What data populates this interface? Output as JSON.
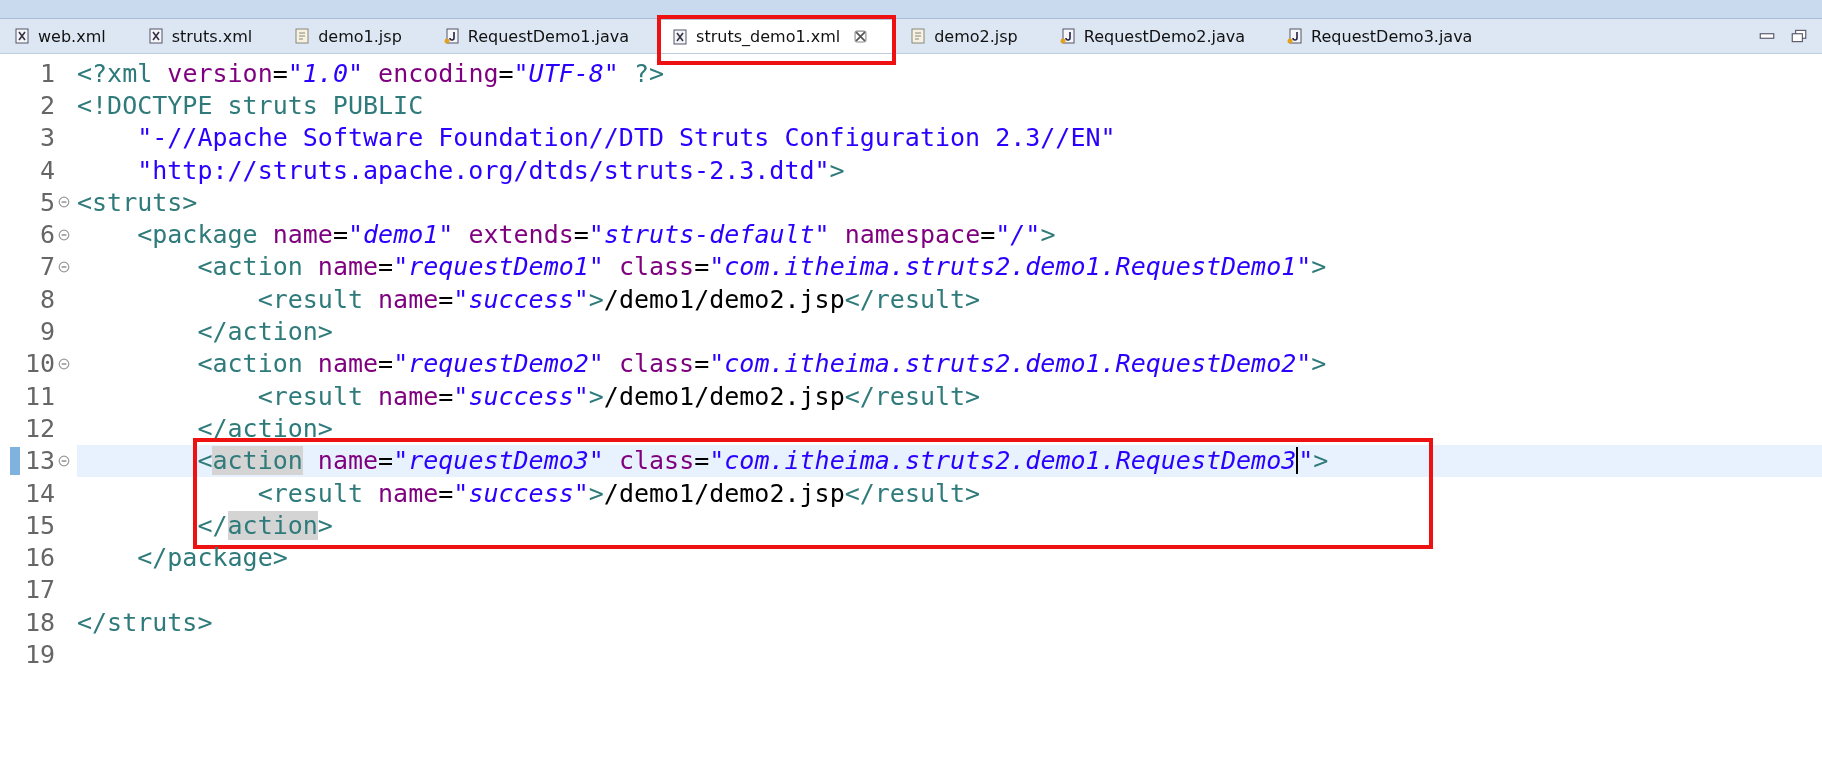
{
  "tabs": [
    {
      "label": "web.xml",
      "kind": "xml",
      "selected": false
    },
    {
      "label": "struts.xml",
      "kind": "xml",
      "selected": false
    },
    {
      "label": "demo1.jsp",
      "kind": "jsp",
      "selected": false
    },
    {
      "label": "RequestDemo1.java",
      "kind": "java",
      "selected": false
    },
    {
      "label": "struts_demo1.xml",
      "kind": "xml",
      "selected": true,
      "boxed": true,
      "closable": true
    },
    {
      "label": "demo2.jsp",
      "kind": "jsp",
      "selected": false
    },
    {
      "label": "RequestDemo2.java",
      "kind": "java",
      "selected": false
    },
    {
      "label": "RequestDemo3.java",
      "kind": "java",
      "selected": false
    }
  ],
  "editor": {
    "sections": [
      {
        "lines": [
          {
            "number": "1",
            "tokens": [
              {
                "kind": "tag",
                "text": "<?xml"
              },
              {
                "kind": "attr",
                "text": " version"
              },
              {
                "kind": "plain",
                "text": "="
              },
              {
                "kind": "value",
                "text": "\"1.0\""
              },
              {
                "kind": "attr",
                "text": " encoding"
              },
              {
                "kind": "plain",
                "text": "="
              },
              {
                "kind": "value",
                "text": "\"UTF-8\""
              },
              {
                "kind": "tag",
                "text": " ?>"
              }
            ]
          },
          {
            "number": "2",
            "tokens": [
              {
                "kind": "tag",
                "text": "<!DOCTYPE struts PUBLIC"
              }
            ]
          },
          {
            "number": "3",
            "tokens": [
              {
                "kind": "string",
                "text": "    \"-//Apache Software Foundation//DTD Struts Configuration 2.3//EN\""
              }
            ]
          },
          {
            "number": "4",
            "tokens": [
              {
                "kind": "string",
                "text": "    \"http://struts.apache.org/dtds/struts-2.3.dtd\""
              },
              {
                "kind": "tag",
                "text": ">"
              }
            ]
          },
          {
            "number": "5",
            "fold": true,
            "tokens": [
              {
                "kind": "tag",
                "text": "<struts>"
              }
            ]
          },
          {
            "number": "6",
            "fold": true,
            "tokens": [
              {
                "kind": "tag",
                "text": "    <package"
              },
              {
                "kind": "attr",
                "text": " name"
              },
              {
                "kind": "plain",
                "text": "="
              },
              {
                "kind": "value",
                "text": "\"demo1\""
              },
              {
                "kind": "attr",
                "text": " extends"
              },
              {
                "kind": "plain",
                "text": "="
              },
              {
                "kind": "value",
                "text": "\"struts-default\""
              },
              {
                "kind": "attr",
                "text": " namespace"
              },
              {
                "kind": "plain",
                "text": "="
              },
              {
                "kind": "value",
                "text": "\"/\""
              },
              {
                "kind": "tag",
                "text": ">"
              }
            ]
          },
          {
            "number": "7",
            "fold": true,
            "tokens": [
              {
                "kind": "tag",
                "text": "        <action"
              },
              {
                "kind": "attr",
                "text": " name"
              },
              {
                "kind": "plain",
                "text": "="
              },
              {
                "kind": "value",
                "text": "\"requestDemo1\""
              },
              {
                "kind": "attr",
                "text": " class"
              },
              {
                "kind": "plain",
                "text": "="
              },
              {
                "kind": "value",
                "text": "\"com.itheima.struts2.demo1.RequestDemo1\""
              },
              {
                "kind": "tag",
                "text": ">"
              }
            ]
          },
          {
            "number": "8",
            "tokens": [
              {
                "kind": "tag",
                "text": "            <result"
              },
              {
                "kind": "attr",
                "text": " name"
              },
              {
                "kind": "plain",
                "text": "="
              },
              {
                "kind": "value",
                "text": "\"success\""
              },
              {
                "kind": "tag",
                "text": ">"
              },
              {
                "kind": "plain",
                "text": "/demo1/demo2.jsp"
              },
              {
                "kind": "tag",
                "text": "</result>"
              }
            ]
          },
          {
            "number": "9",
            "tokens": [
              {
                "kind": "tag",
                "text": "        </action>"
              }
            ]
          },
          {
            "number": "10",
            "fold": true,
            "tokens": [
              {
                "kind": "tag",
                "text": "        <action"
              },
              {
                "kind": "attr",
                "text": " name"
              },
              {
                "kind": "plain",
                "text": "="
              },
              {
                "kind": "value",
                "text": "\"requestDemo2\""
              },
              {
                "kind": "attr",
                "text": " class"
              },
              {
                "kind": "plain",
                "text": "="
              },
              {
                "kind": "value",
                "text": "\"com.itheima.struts2.demo1.RequestDemo2\""
              },
              {
                "kind": "tag",
                "text": ">"
              }
            ]
          },
          {
            "number": "11",
            "tokens": [
              {
                "kind": "tag",
                "text": "            <result"
              },
              {
                "kind": "attr",
                "text": " name"
              },
              {
                "kind": "plain",
                "text": "="
              },
              {
                "kind": "value",
                "text": "\"success\""
              },
              {
                "kind": "tag",
                "text": ">"
              },
              {
                "kind": "plain",
                "text": "/demo1/demo2.jsp"
              },
              {
                "kind": "tag",
                "text": "</result>"
              }
            ]
          },
          {
            "number": "12",
            "tokens": [
              {
                "kind": "tag",
                "text": "        </action>"
              }
            ]
          }
        ]
      },
      {
        "boxed": true,
        "lines": [
          {
            "number": "13",
            "fold": true,
            "current": true,
            "tokens": [
              {
                "kind": "tag",
                "text": "        <"
              },
              {
                "kind": "match",
                "text": "action"
              },
              {
                "kind": "attr",
                "text": " name"
              },
              {
                "kind": "plain",
                "text": "="
              },
              {
                "kind": "value",
                "text": "\"requestDemo3\""
              },
              {
                "kind": "attr",
                "text": " class"
              },
              {
                "kind": "plain",
                "text": "="
              },
              {
                "kind": "value",
                "text": "\"com.itheima.struts2.demo1.RequestDemo3"
              },
              {
                "kind": "cursor"
              },
              {
                "kind": "value",
                "text": "\""
              },
              {
                "kind": "tag",
                "text": ">"
              }
            ]
          },
          {
            "number": "14",
            "tokens": [
              {
                "kind": "tag",
                "text": "            <result"
              },
              {
                "kind": "attr",
                "text": " name"
              },
              {
                "kind": "plain",
                "text": "="
              },
              {
                "kind": "value",
                "text": "\"success\""
              },
              {
                "kind": "tag",
                "text": ">"
              },
              {
                "kind": "plain",
                "text": "/demo1/demo2.jsp"
              },
              {
                "kind": "tag",
                "text": "</result>"
              }
            ]
          },
          {
            "number": "15",
            "tokens": [
              {
                "kind": "tag",
                "text": "        </"
              },
              {
                "kind": "match",
                "text": "action"
              },
              {
                "kind": "tag",
                "text": ">"
              }
            ]
          }
        ]
      },
      {
        "lines": [
          {
            "number": "16",
            "tokens": [
              {
                "kind": "tag",
                "text": "    </package>"
              }
            ]
          },
          {
            "number": "17"
          },
          {
            "number": "18",
            "tokens": [
              {
                "kind": "tag",
                "text": "</struts>"
              }
            ]
          },
          {
            "number": "19"
          }
        ]
      }
    ]
  }
}
